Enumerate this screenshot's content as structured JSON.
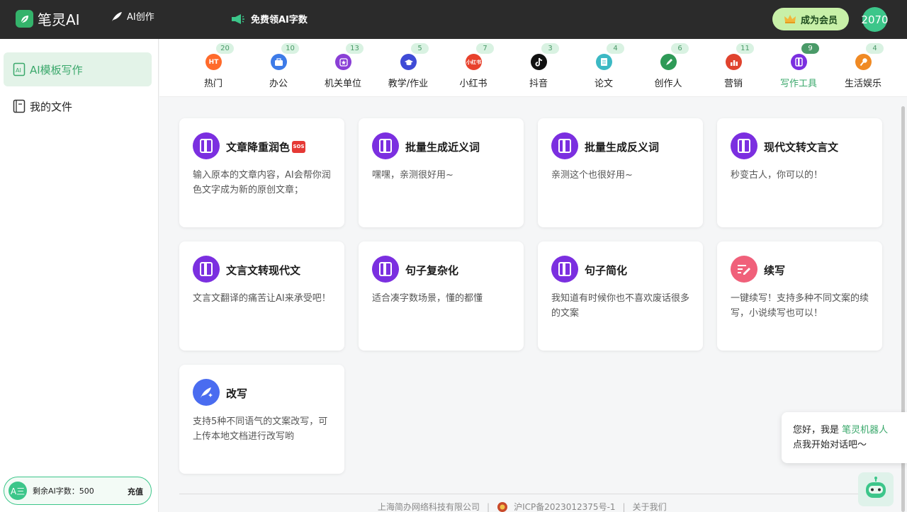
{
  "header": {
    "app_name": "笔灵AI",
    "nav_create": "AI创作",
    "nav_free": "免费领AI字数",
    "vip_button": "成为会员",
    "avatar_text": "2070"
  },
  "sidebar": {
    "items": [
      {
        "label": "AI模板写作",
        "icon": "template-writing-icon",
        "active": true
      },
      {
        "label": "我的文件",
        "icon": "document-icon",
        "active": false
      }
    ],
    "quota_badge": "A三",
    "quota_label": "剩余AI字数：500",
    "recharge_label": "充值"
  },
  "categories": [
    {
      "label": "热门",
      "count": "20",
      "icon": "hot-icon",
      "icon_text": "HT",
      "color": "#ff6a2b"
    },
    {
      "label": "办公",
      "count": "10",
      "icon": "briefcase-icon",
      "icon_text": "",
      "color": "#3d7be8"
    },
    {
      "label": "机关单位",
      "count": "13",
      "icon": "star-badge-icon",
      "icon_text": "",
      "color": "#8a3fd6"
    },
    {
      "label": "教学/作业",
      "count": "5",
      "icon": "graduation-cap-icon",
      "icon_text": "",
      "color": "#3f4bd6"
    },
    {
      "label": "小红书",
      "count": "7",
      "icon": "xiaohongshu-icon",
      "icon_text": "小红书",
      "color": "#e8412c"
    },
    {
      "label": "抖音",
      "count": "3",
      "icon": "tiktok-icon",
      "icon_text": "",
      "color": "#111111"
    },
    {
      "label": "论文",
      "count": "4",
      "icon": "paper-icon",
      "icon_text": "",
      "color": "#3cb9c4"
    },
    {
      "label": "创作人",
      "count": "6",
      "icon": "pen-nib-icon",
      "icon_text": "",
      "color": "#2e9a57"
    },
    {
      "label": "营销",
      "count": "11",
      "icon": "bar-chart-icon",
      "icon_text": "",
      "color": "#e0432e"
    },
    {
      "label": "写作工具",
      "count": "9",
      "icon": "notebook-icon",
      "icon_text": "",
      "color": "#7b2fe0",
      "active": true
    },
    {
      "label": "生活娱乐",
      "count": "4",
      "icon": "microphone-icon",
      "icon_text": "",
      "color": "#f08a24"
    }
  ],
  "cards": [
    {
      "title": "文章降重润色",
      "sos": "SOS",
      "desc": "输入原本的文章内容，AI会帮你润色文字成为新的原创文章；",
      "icon": "notebook-icon",
      "color": "#7b2fe0"
    },
    {
      "title": "批量生成近义词",
      "desc": "嘿嘿，亲测很好用~",
      "icon": "notebook-icon",
      "color": "#7b2fe0"
    },
    {
      "title": "批量生成反义词",
      "desc": "亲测这个也很好用~",
      "icon": "notebook-icon",
      "color": "#7b2fe0"
    },
    {
      "title": "现代文转文言文",
      "desc": "秒变古人，你可以的！",
      "icon": "notebook-icon",
      "color": "#7b2fe0"
    },
    {
      "title": "文言文转现代文",
      "desc": "文言文翻译的痛苦让AI来承受吧！",
      "icon": "notebook-icon",
      "color": "#7b2fe0"
    },
    {
      "title": "句子复杂化",
      "desc": "适合凑字数场景，懂的都懂",
      "icon": "notebook-icon",
      "color": "#7b2fe0"
    },
    {
      "title": "句子简化",
      "desc": "我知道有时候你也不喜欢废话很多的文案",
      "icon": "notebook-icon",
      "color": "#7b2fe0"
    },
    {
      "title": "续写",
      "desc": "一键续写！支持多种不同文案的续写，小说续写也可以！",
      "icon": "edit-plus-icon",
      "color": "#f0607a"
    },
    {
      "title": "改写",
      "desc": "支持5种不同语气的文案改写，可上传本地文档进行改写哟",
      "icon": "feather-sparkle-icon",
      "color": "#4a6cf0"
    }
  ],
  "footer": {
    "company": "上海简办网络科技有限公司",
    "icp": "沪ICP备2023012375号-1",
    "about": "关于我们"
  },
  "chat": {
    "greeting": "您好，我是",
    "bot_name": "笔灵机器人",
    "prompt": "点我开始对话吧～"
  }
}
